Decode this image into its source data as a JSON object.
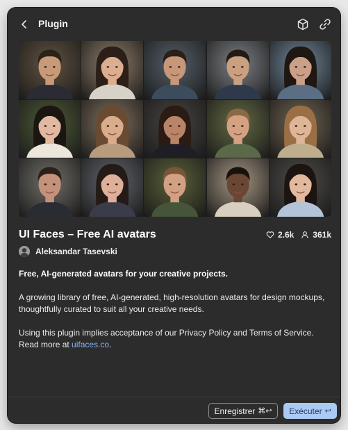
{
  "header": {
    "title": "Plugin"
  },
  "plugin": {
    "name": "UI Faces – Free AI avatars",
    "likes": "2.6k",
    "users": "361k",
    "author": "Aleksandar Tasevski"
  },
  "description": {
    "tagline": "Free, AI-generated avatars for your creative projects.",
    "body": "A growing library of free, AI-generated, high-resolution avatars for design mockups, thoughtfully curated to suit all your creative needs.",
    "notice_prefix": "Using this plugin implies acceptance of our Privacy Policy and Terms of Service. Read more at ",
    "link_text": "uifaces.co",
    "notice_suffix": "."
  },
  "footer": {
    "save_label": "Enregistrer",
    "save_shortcut": "⌘↩",
    "run_label": "Exécuter",
    "run_shortcut": "↩"
  },
  "icons": {
    "back": "chevron-left-icon",
    "package": "package-icon",
    "link": "link-icon",
    "like": "heart-icon",
    "users": "user-icon"
  },
  "colors": {
    "panel": "#2c2c2c",
    "link": "#84b6f6",
    "primary_button": "#aac9f3"
  }
}
